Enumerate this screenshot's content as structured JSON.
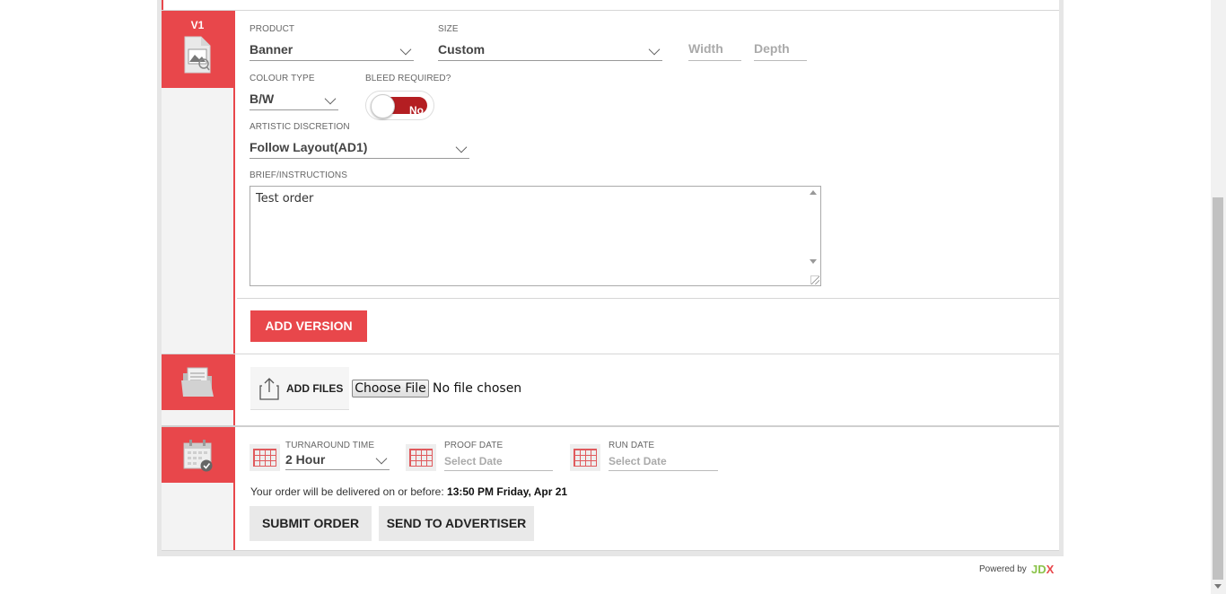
{
  "version": {
    "label": "V1",
    "product_label": "PRODUCT",
    "product_value": "Banner",
    "size_label": "SIZE",
    "size_value": "Custom",
    "width_placeholder": "Width",
    "depth_placeholder": "Depth",
    "colour_label": "COLOUR TYPE",
    "colour_value": "B/W",
    "bleed_label": "BLEED REQUIRED?",
    "bleed_value": "No",
    "artistic_label": "ARTISTIC DISCRETION",
    "artistic_value": "Follow Layout(AD1)",
    "brief_label": "BRIEF/INSTRUCTIONS",
    "brief_value": "Test order",
    "add_version_label": "ADD VERSION"
  },
  "files": {
    "add_files_label": "ADD FILES",
    "choose_file_label": "Choose File",
    "no_file_text": "No file chosen"
  },
  "schedule": {
    "turnaround_label": "TURNAROUND TIME",
    "turnaround_value": "2 Hour",
    "proof_label": "PROOF DATE",
    "proof_placeholder": "Select Date",
    "run_label": "RUN DATE",
    "run_placeholder": "Select Date",
    "delivery_prefix": "Your order will be delivered on or before:",
    "delivery_value": "13:50 PM Friday, Apr 21",
    "submit_label": "SUBMIT ORDER",
    "send_label": "SEND TO ADVERTISER"
  },
  "footer": {
    "powered_by": "Powered by",
    "brand_jd": "JD",
    "brand_x": "X"
  },
  "colors": {
    "accent_red": "#e8474b",
    "toggle_red": "#b41e22",
    "brand_green": "#8bc34a"
  }
}
